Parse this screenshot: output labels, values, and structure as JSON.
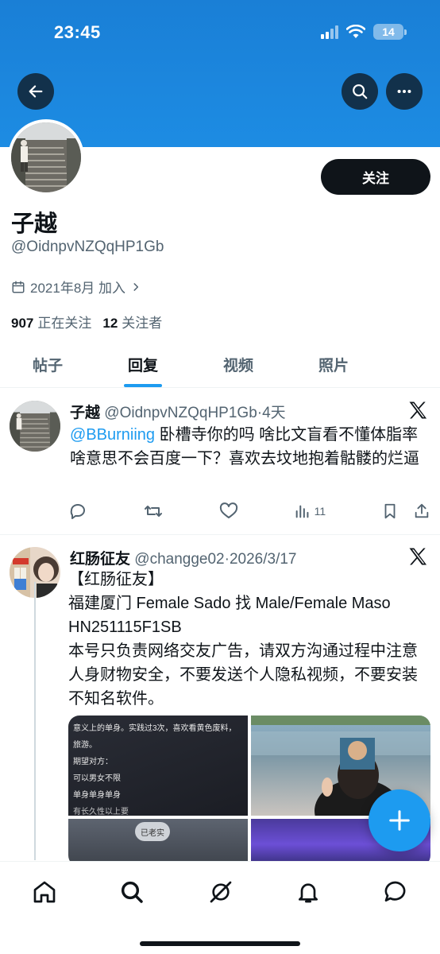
{
  "status_bar": {
    "time": "23:45",
    "battery": "14"
  },
  "header": {
    "back_icon": "arrow-left-icon",
    "search_icon": "search-icon",
    "more_icon": "more-horizontal-icon",
    "banner_color": "#1d8ce3"
  },
  "profile": {
    "display_name": "子越",
    "handle": "@OidnpvNZQqHP1Gb",
    "follow_label": "关注",
    "joined": "2021年8月 加入",
    "following_count": "907",
    "following_label": "正在关注",
    "followers_count": "12",
    "followers_label": "关注者"
  },
  "tabs": [
    {
      "label": "帖子",
      "active": false
    },
    {
      "label": "回复",
      "active": true
    },
    {
      "label": "视频",
      "active": false
    },
    {
      "label": "照片",
      "active": false
    }
  ],
  "posts": [
    {
      "name": "子越",
      "handle": "@OidnpvNZQqHP1Gb",
      "sep": "·",
      "time": "4天",
      "mention": "@BBurniing",
      "text": " 卧槽寺你的吗 啥比文盲看不懂体脂率啥意思不会百度一下？喜欢去坟地抱着骷髅的烂逼",
      "views": "11"
    },
    {
      "name": "红肠征友",
      "handle": "@changge02",
      "sep": "·",
      "time": "2026/3/17",
      "line1": "【红肠征友】",
      "line2": "福建厦门 Female Sado 找 Male/Female Maso",
      "line3": "HN251115F1SB",
      "line4": "本号只负责网络交友广告，请双方沟通过程中注意人身财物安全，不要发送个人隐私视频，不要安装不知名软件。",
      "media_text": {
        "t1": "意义上的单身。实践过3次，喜欢看黄色废料，旅游。",
        "t2": "期望对方：",
        "t3": "可以男女不限",
        "t4": "单身单身单身",
        "t5": "有长久性以上要",
        "sign": "已老实"
      }
    }
  ],
  "bottom_nav": [
    "home-icon",
    "search-icon",
    "grok-icon",
    "bell-icon",
    "messages-icon"
  ],
  "colors": {
    "accent": "#1d9bf0",
    "text": "#0f1419",
    "secondary": "#536471"
  }
}
